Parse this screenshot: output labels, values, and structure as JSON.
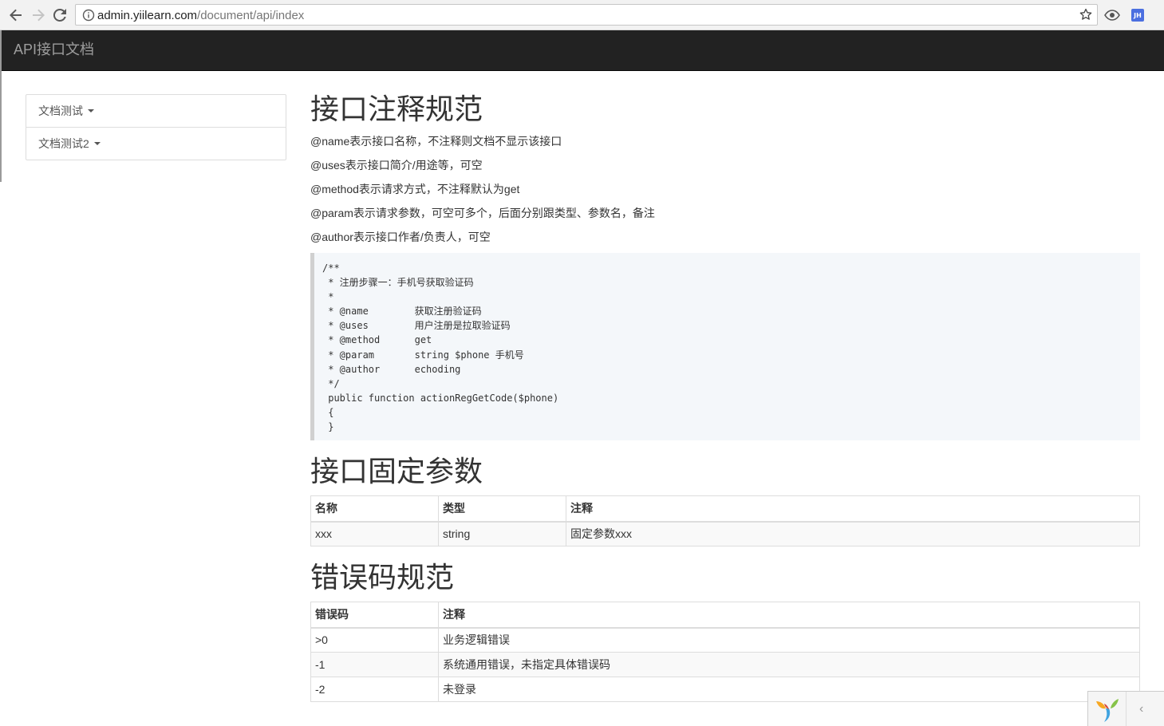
{
  "browser": {
    "url_host": "admin.yiilearn.com",
    "url_path": "/document/api/index",
    "extension_label": "JH"
  },
  "navbar": {
    "brand": "API接口文档"
  },
  "sidebar": {
    "items": [
      {
        "label": "文档测试"
      },
      {
        "label": "文档测试2"
      }
    ]
  },
  "sections": {
    "annotation": {
      "title": "接口注释规范",
      "rules": [
        "@name表示接口名称，不注释则文档不显示该接口",
        "@uses表示接口简介/用途等，可空",
        "@method表示请求方式，不注释默认为get",
        "@param表示请求参数，可空可多个，后面分别跟类型、参数名，备注",
        "@author表示接口作者/负责人，可空"
      ],
      "code": "/**\n * 注册步骤一：手机号获取验证码\n *\n * @name        获取注册验证码\n * @uses        用户注册是拉取验证码\n * @method      get\n * @param       string $phone 手机号\n * @author      echoding\n */\n public function actionRegGetCode($phone)\n {\n }"
    },
    "fixed_params": {
      "title": "接口固定参数",
      "headers": [
        "名称",
        "类型",
        "注释"
      ],
      "rows": [
        [
          "xxx",
          "string",
          "固定参数xxx"
        ]
      ]
    },
    "error_codes": {
      "title": "错误码规范",
      "headers": [
        "错误码",
        "注释"
      ],
      "rows": [
        [
          ">0",
          "业务逻辑错误"
        ],
        [
          "-1",
          "系统通用错误，未指定具体错误码"
        ],
        [
          "-2",
          "未登录"
        ]
      ]
    }
  },
  "debug_toolbar": {
    "toggle_glyph": "‹"
  }
}
